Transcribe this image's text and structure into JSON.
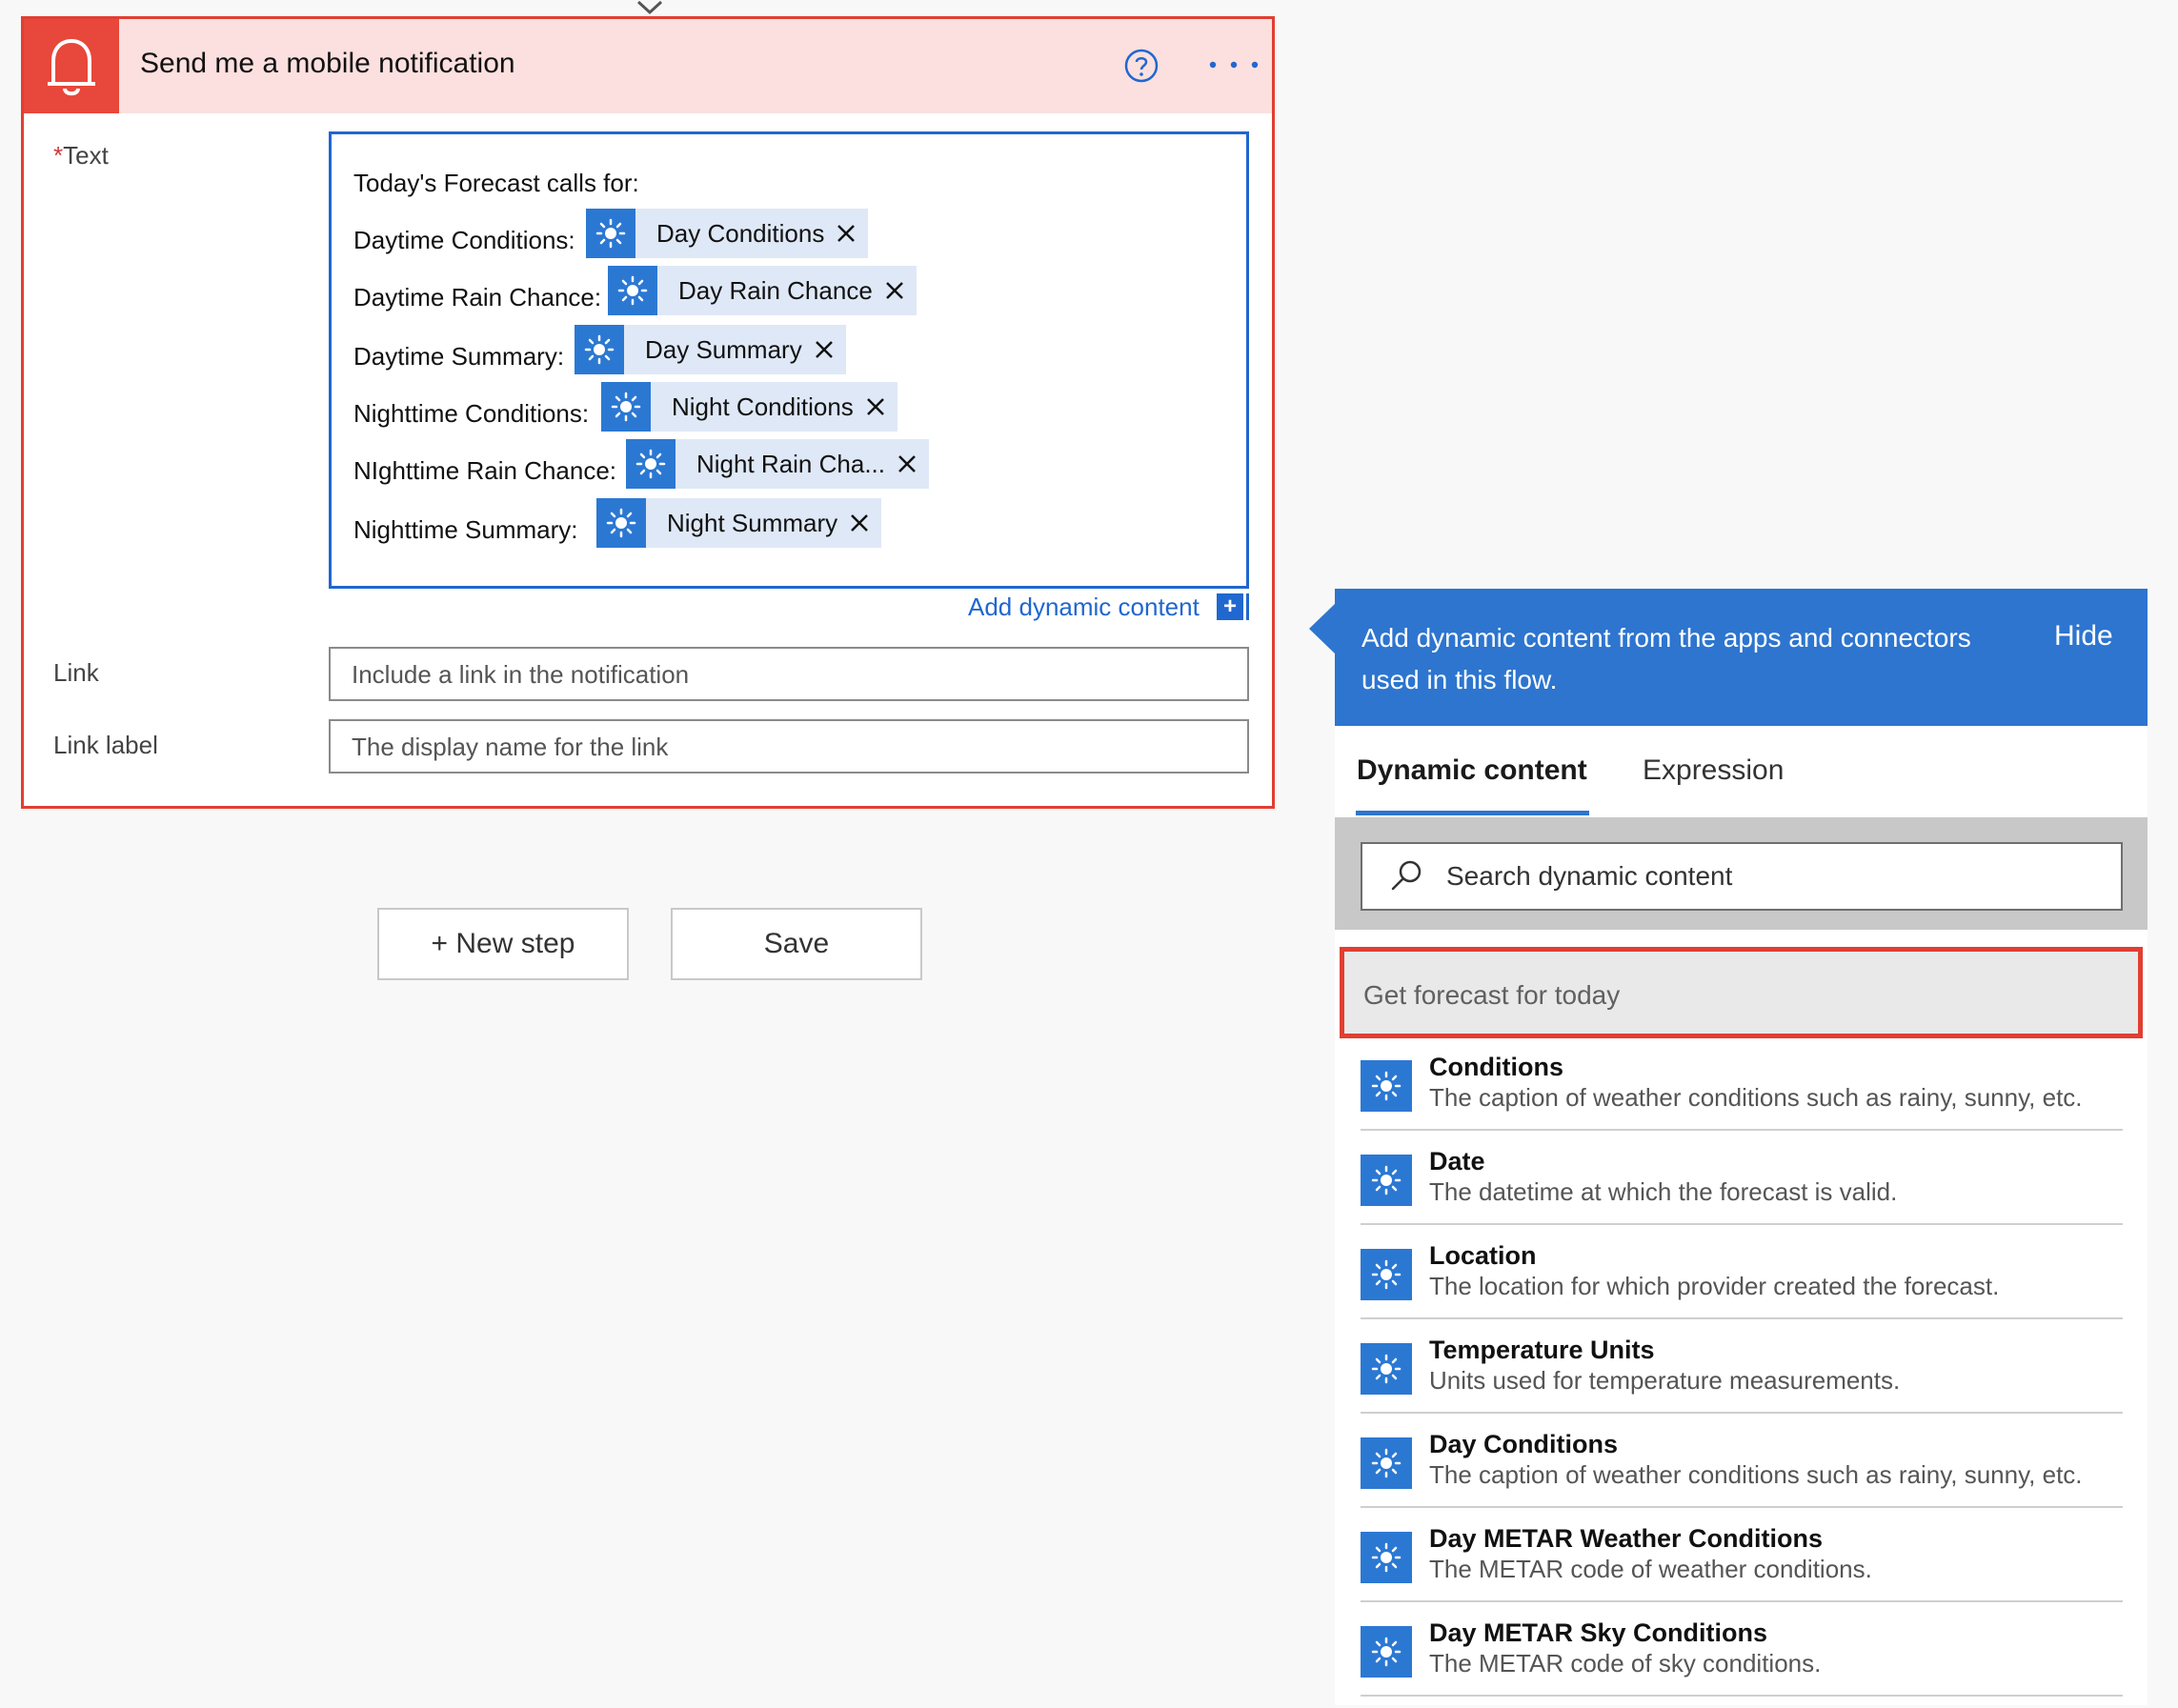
{
  "card": {
    "title": "Send me a mobile notification",
    "header_color": "#fbe0df",
    "accent_color": "#e8473b",
    "icons": {
      "trigger": "bell-icon",
      "help": "help-icon",
      "menu": "more-options-icon"
    }
  },
  "text_field": {
    "required_marker": "*",
    "label": "Text",
    "intro_line": "Today's Forecast calls for:",
    "lines": [
      {
        "label": "Daytime Conditions:",
        "token": "Day Conditions"
      },
      {
        "label": "Daytime Rain Chance:",
        "token": "Day Rain Chance"
      },
      {
        "label": "Daytime Summary:",
        "token": "Day Summary"
      },
      {
        "label": "Nighttime Conditions:",
        "token": "Night Conditions"
      },
      {
        "label": "NIghttime Rain Chance:",
        "token": "Night Rain Cha..."
      },
      {
        "label": "Nighttime Summary:",
        "token": "Night Summary"
      }
    ],
    "token_icon": "sun-icon",
    "add_dynamic_content": "Add dynamic content",
    "add_icon_glyph": "+"
  },
  "link_field": {
    "label": "Link",
    "placeholder": "Include a link in the notification",
    "value": ""
  },
  "link_label_field": {
    "label": "Link label",
    "placeholder": "The display name for the link",
    "value": ""
  },
  "buttons": {
    "new_step": "+ New step",
    "save": "Save"
  },
  "dynamic_panel": {
    "header_text": "Add dynamic content from the apps and connectors used in this flow.",
    "hide": "Hide",
    "header_color": "#2d75cf",
    "tabs": [
      {
        "label": "Dynamic content",
        "active": true
      },
      {
        "label": "Expression",
        "active": false
      }
    ],
    "search_placeholder": "Search dynamic content",
    "group_title": "Get forecast for today",
    "items": [
      {
        "title": "Conditions",
        "description": "The caption of weather conditions such as rainy, sunny, etc."
      },
      {
        "title": "Date",
        "description": "The datetime at which the forecast is valid."
      },
      {
        "title": "Location",
        "description": "The location for which provider created the forecast."
      },
      {
        "title": "Temperature Units",
        "description": "Units used for temperature measurements."
      },
      {
        "title": "Day Conditions",
        "description": "The caption of weather conditions such as rainy, sunny, etc."
      },
      {
        "title": "Day METAR Weather Conditions",
        "description": "The METAR code of weather conditions."
      },
      {
        "title": "Day METAR Sky Conditions",
        "description": "The METAR code of sky conditions."
      }
    ]
  }
}
